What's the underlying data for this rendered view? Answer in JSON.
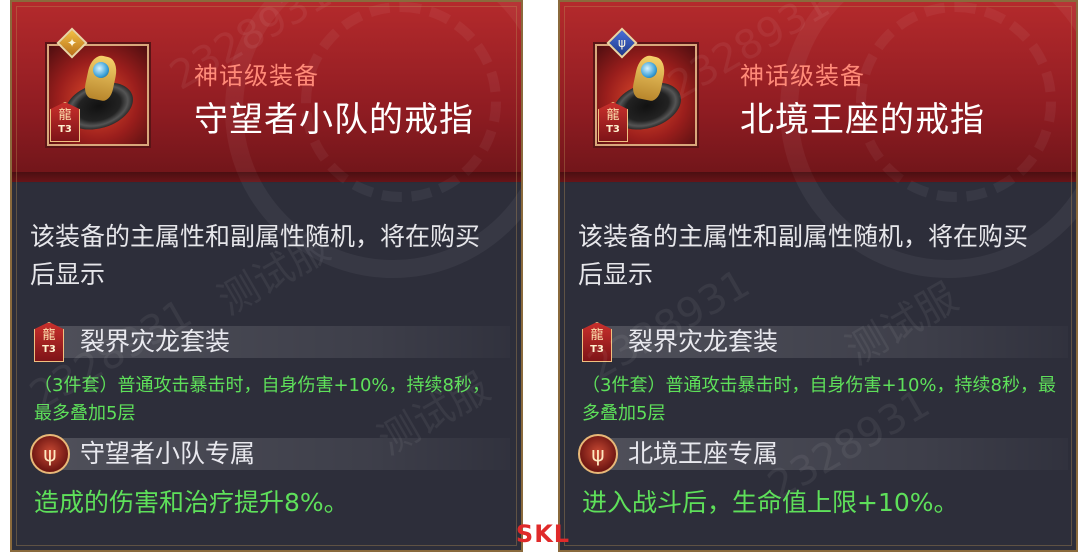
{
  "cards": [
    {
      "rarity": "神话级装备",
      "name": "守望者小队的戒指",
      "tier": "T3",
      "description": "该装备的主属性和副属性随机，将在购买后显示",
      "set": {
        "name": "裂界灾龙套装",
        "effect": "（3件套）普通攻击暴击时，自身伤害+10%，持续8秒，最多叠加5层"
      },
      "exclusive": {
        "name": "守望者小队专属",
        "effect": "造成的伤害和治疗提升8%。"
      },
      "badge_color": "#f3c044"
    },
    {
      "rarity": "神话级装备",
      "name": "北境王座的戒指",
      "tier": "T3",
      "description": "该装备的主属性和副属性随机，将在购买后显示",
      "set": {
        "name": "裂界灾龙套装",
        "effect": "（3件套）普通攻击暴击时，自身伤害+10%，持续8秒，最多叠加5层"
      },
      "exclusive": {
        "name": "北境王座专属",
        "effect": "进入战斗后，生命值上限+10%。"
      },
      "badge_color": "#4a6fd8"
    }
  ],
  "watermark": {
    "text": "测试服",
    "number": "2328931"
  },
  "site_mark": "SKL",
  "colors": {
    "header_red": "#b42a2c",
    "body_bg": "#2d2e3a",
    "rarity_text": "#ff8a78",
    "effect_green": "#5ee05a",
    "frame_gold": "#8a6a3c"
  },
  "icons": {
    "item": "ring-icon",
    "tier_badge": "dragon-t3-icon",
    "exclusive": "trident-emblem-icon"
  }
}
